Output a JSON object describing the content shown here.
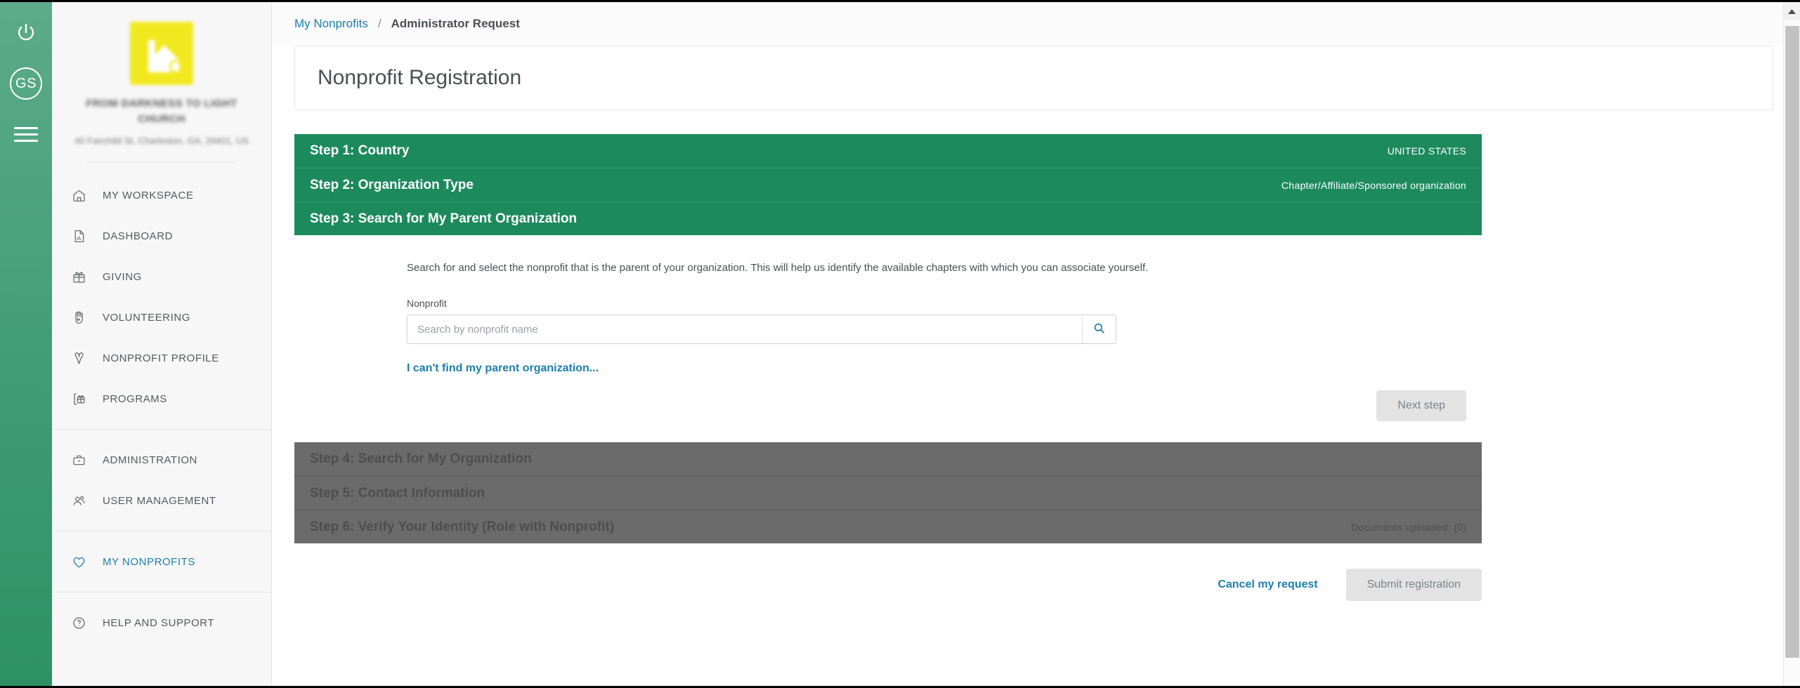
{
  "rail": {
    "power_icon": "power-icon",
    "avatar_initials": "GS",
    "menu_icon": "hamburger-icon"
  },
  "sidebar": {
    "org_logo": "organization-logo",
    "org_name": "FROM DARKNESS TO LIGHT CHURCH",
    "org_address": "40 Fairchild St, Charleston, GA, 29401, US",
    "groups": [
      {
        "items": [
          {
            "label": "MY WORKSPACE",
            "icon": "home-icon",
            "active": false
          },
          {
            "label": "DASHBOARD",
            "icon": "document-chart-icon",
            "active": false
          },
          {
            "label": "GIVING",
            "icon": "gift-icon",
            "active": false
          },
          {
            "label": "VOLUNTEERING",
            "icon": "hand-heart-icon",
            "active": false
          },
          {
            "label": "NONPROFIT PROFILE",
            "icon": "ribbon-icon",
            "active": false
          },
          {
            "label": "PROGRAMS",
            "icon": "clipboard-gift-icon",
            "active": false
          }
        ]
      },
      {
        "items": [
          {
            "label": "ADMINISTRATION",
            "icon": "briefcase-icon",
            "active": false
          },
          {
            "label": "USER MANAGEMENT",
            "icon": "users-icon",
            "active": false
          }
        ]
      },
      {
        "items": [
          {
            "label": "MY NONPROFITS",
            "icon": "heart-icon",
            "active": true
          }
        ]
      },
      {
        "items": [
          {
            "label": "HELP AND SUPPORT",
            "icon": "question-circle-icon",
            "active": false
          }
        ]
      }
    ]
  },
  "breadcrumb": {
    "parent": "My Nonprofits",
    "separator": "/",
    "current": "Administrator Request"
  },
  "page": {
    "title": "Nonprofit Registration"
  },
  "wizard": {
    "completed_steps": [
      {
        "label": "Step 1: Country",
        "value": "UNITED STATES"
      },
      {
        "label": "Step 2: Organization Type",
        "value": "Chapter/Affiliate/Sponsored organization"
      },
      {
        "label": "Step 3: Search for My Parent Organization",
        "value": ""
      }
    ],
    "active_step": {
      "helper_text": "Search for and select the nonprofit that is the parent of your organization. This will help us identify the available chapters with which you can associate yourself.",
      "field_label": "Nonprofit",
      "search_placeholder": "Search by nonprofit name",
      "search_value": "",
      "search_icon": "search-icon",
      "cant_find_link": "I can't find my parent organization...",
      "next_button": "Next step"
    },
    "disabled_steps": [
      {
        "label": "Step 4: Search for My Organization",
        "value": ""
      },
      {
        "label": "Step 5: Contact Information",
        "value": ""
      },
      {
        "label": "Step 6: Verify Your Identity (Role with Nonprofit)",
        "value": "Documents uploaded: (0)"
      }
    ]
  },
  "actions": {
    "cancel": "Cancel my request",
    "submit": "Submit registration"
  },
  "colors": {
    "rail_green": "#3f9c76",
    "step_green": "#1d8a5e",
    "step_disabled_gray": "#6b6b6b",
    "link_blue": "#1b7fad",
    "logo_yellow": "#f2e81f"
  }
}
